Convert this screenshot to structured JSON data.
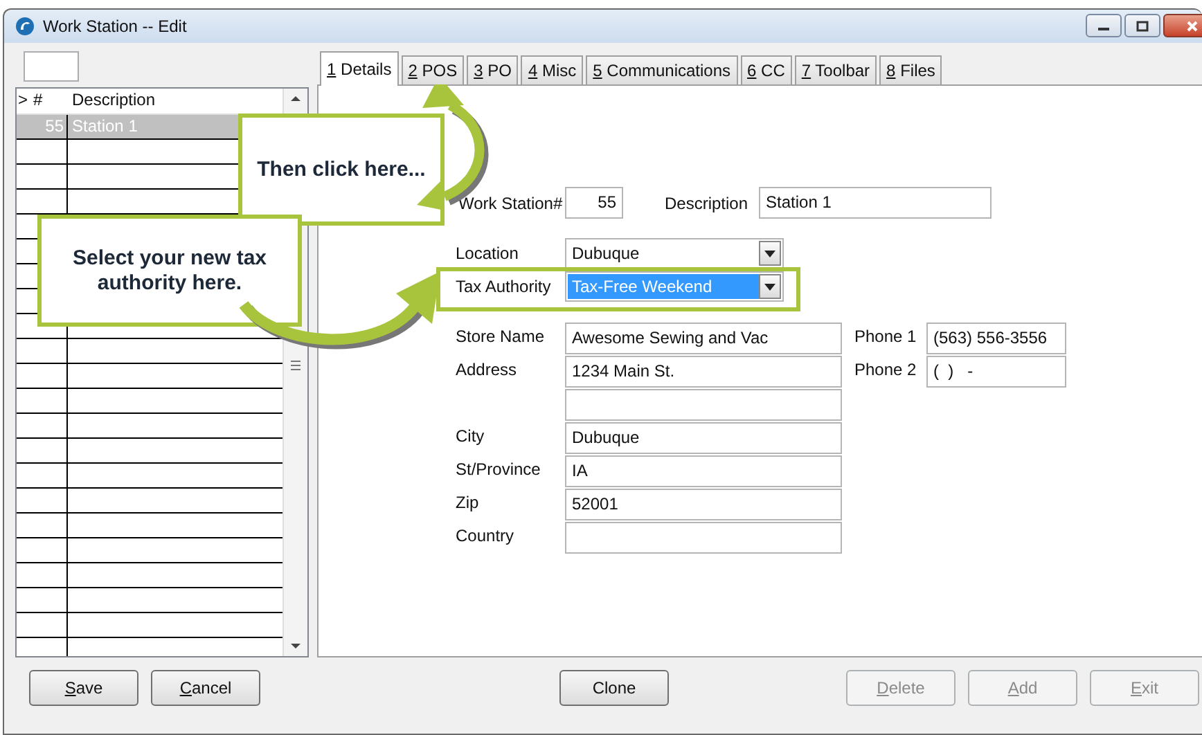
{
  "window": {
    "title": "Work Station -- Edit"
  },
  "grid": {
    "columns": [
      ">",
      "#",
      "Description"
    ],
    "rows": [
      {
        "number": "55",
        "description": "Station 1",
        "selected": true
      }
    ]
  },
  "tabs": [
    {
      "key": "1",
      "label": "Details",
      "selected": true
    },
    {
      "key": "2",
      "label": "POS",
      "selected": false
    },
    {
      "key": "3",
      "label": "PO",
      "selected": false
    },
    {
      "key": "4",
      "label": "Misc",
      "selected": false
    },
    {
      "key": "5",
      "label": "Communications",
      "selected": false
    },
    {
      "key": "6",
      "label": "CC",
      "selected": false
    },
    {
      "key": "7",
      "label": "Toolbar",
      "selected": false
    },
    {
      "key": "8",
      "label": "Files",
      "selected": false
    }
  ],
  "details": {
    "work_station": {
      "label": "Work Station#",
      "value": "55"
    },
    "description": {
      "label": "Description",
      "value": "Station 1"
    },
    "location": {
      "label": "Location",
      "value": "Dubuque",
      "text_selected": false
    },
    "tax_authority": {
      "label": "Tax Authority",
      "value": "Tax-Free Weekend",
      "text_selected": true
    },
    "address_fields": [
      {
        "kind": "labeled",
        "label": "Store Name",
        "value": "Awesome Sewing and Vac"
      },
      {
        "kind": "labeled",
        "label": "Address",
        "value": "1234 Main St."
      },
      {
        "kind": "continuation"
      },
      {
        "kind": "labeled",
        "label": "City",
        "value": "Dubuque"
      },
      {
        "kind": "labeled",
        "label": "St/Province",
        "value": "IA"
      },
      {
        "kind": "labeled",
        "label": "Zip",
        "value": "52001"
      },
      {
        "kind": "labeled",
        "label": "Country"
      }
    ],
    "phones": [
      {
        "label": "Phone 1",
        "value": "(563) 556-3556"
      },
      {
        "label": "Phone 2",
        "value": "(  )   -"
      }
    ]
  },
  "buttons": [
    {
      "label": "Save",
      "underline_first": true,
      "disabled": false
    },
    {
      "label": "Cancel",
      "underline_first": true,
      "disabled": false
    },
    {
      "label": "Clone",
      "underline_first": false,
      "disabled": false
    },
    {
      "label": "Delete",
      "underline_first": true,
      "disabled": true
    },
    {
      "label": "Add",
      "underline_first": true,
      "disabled": true
    },
    {
      "label": "Exit",
      "underline_first": true,
      "disabled": true
    }
  ],
  "callouts": [
    {
      "text": "Then click here..."
    },
    {
      "text": "Select your new tax authority here."
    }
  ]
}
